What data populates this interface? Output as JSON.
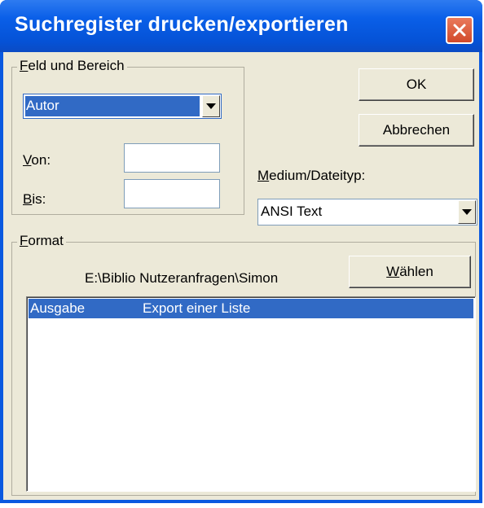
{
  "window": {
    "title": "Suchregister drucken/exportieren"
  },
  "feld_und_bereich": {
    "label_mnemonic": "F",
    "label_rest": "eld und Bereich",
    "field_value": "Autor",
    "von_mnemonic": "V",
    "von_rest": "on:",
    "von_value": "",
    "bis_mnemonic": "B",
    "bis_rest": "is:",
    "bis_value": ""
  },
  "buttons": {
    "ok": "OK",
    "cancel": "Abbrechen",
    "choose_mnemonic": "W",
    "choose_rest": "ählen"
  },
  "medium": {
    "label_mnemonic": "M",
    "label_rest": "edium/Dateityp:",
    "value": "ANSI Text"
  },
  "format": {
    "label_mnemonic": "F",
    "label_rest": "ormat",
    "path": "E:\\Biblio Nutzeranfragen\\Simon",
    "list": [
      {
        "name": "Ausgabe",
        "description": "Export einer Liste",
        "selected": true
      }
    ]
  }
}
